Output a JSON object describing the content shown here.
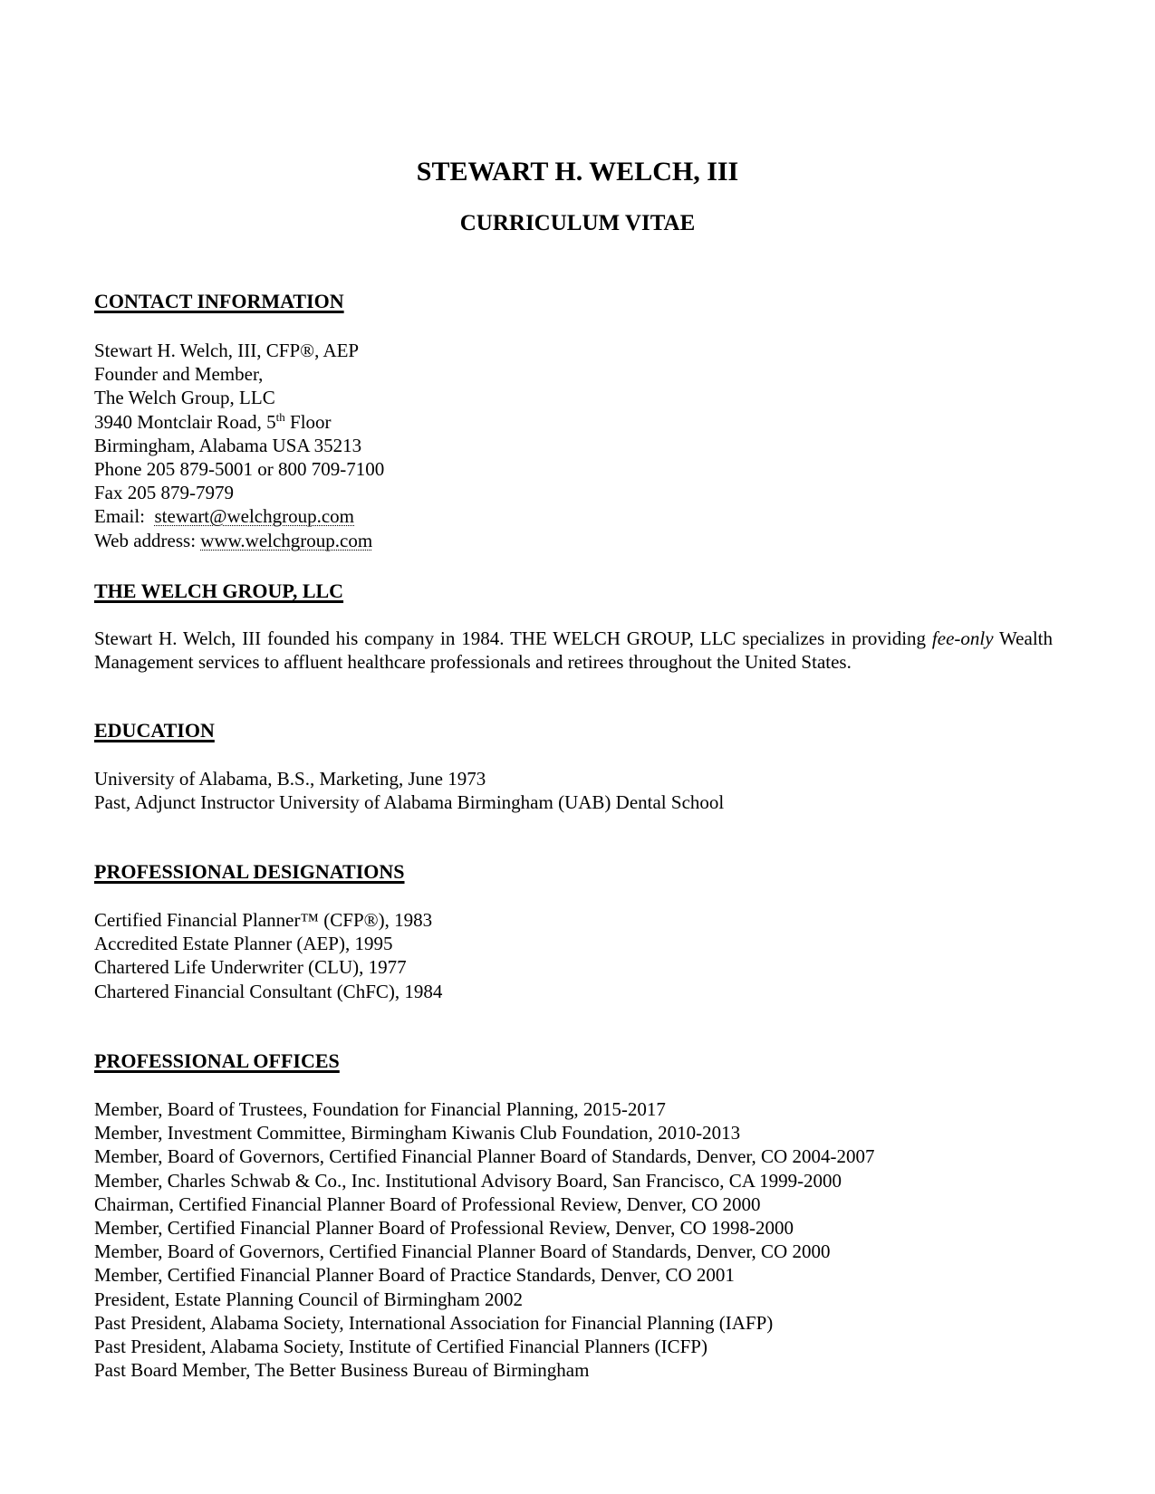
{
  "header": {
    "name": "STEWART H. WELCH, III",
    "subtitle": "CURRICULUM VITAE"
  },
  "contact": {
    "heading": "CONTACT INFORMATION",
    "name_line": "Stewart H. Welch, III, CFP®, AEP",
    "role_line": "Founder and Member,",
    "company_line": "The Welch Group, LLC",
    "address_prefix": "3940 Montclair Road, 5",
    "address_sup": "th",
    "address_suffix": " Floor",
    "city_line": "Birmingham, Alabama USA  35213",
    "phone_line": "Phone 205 879-5001 or 800 709-7100",
    "fax_line": "Fax 205 879-7979",
    "email_label": "Email:  ",
    "email": "stewart@welchgroup.com",
    "web_label": "Web address: ",
    "web": "www.welchgroup.com"
  },
  "company": {
    "heading": "THE WELCH GROUP, LLC",
    "text_before": "Stewart H. Welch, III founded his company in 1984.  THE WELCH GROUP, LLC specializes in providing ",
    "emphasis": "fee-only",
    "text_after": " Wealth Management services to affluent healthcare professionals and retirees throughout the United States."
  },
  "education": {
    "heading": "EDUCATION",
    "items": [
      "University of Alabama, B.S., Marketing, June 1973",
      "Past, Adjunct Instructor University of Alabama Birmingham (UAB) Dental School"
    ]
  },
  "designations": {
    "heading": "PROFESSIONAL DESIGNATIONS",
    "items": [
      "Certified Financial Planner™ (CFP®), 1983",
      "Accredited Estate Planner (AEP), 1995",
      "Chartered Life Underwriter (CLU), 1977",
      "Chartered Financial Consultant (ChFC), 1984"
    ]
  },
  "offices": {
    "heading": "PROFESSIONAL OFFICES",
    "items": [
      "Member, Board of Trustees, Foundation for Financial Planning, 2015-2017",
      "Member, Investment Committee, Birmingham Kiwanis Club Foundation, 2010-2013",
      "Member, Board of Governors, Certified Financial Planner Board of Standards, Denver, CO  2004-2007",
      "Member, Charles Schwab & Co., Inc. Institutional Advisory Board, San Francisco, CA 1999-2000",
      "Chairman, Certified Financial Planner Board of Professional Review, Denver, CO  2000",
      "Member, Certified Financial Planner Board of Professional Review, Denver, CO  1998-2000",
      "Member, Board of Governors, Certified Financial Planner Board of Standards, Denver, CO  2000",
      "Member, Certified Financial Planner Board of Practice Standards, Denver, CO  2001",
      "President, Estate Planning Council of Birmingham 2002",
      "Past President, Alabama Society, International Association for Financial Planning (IAFP)",
      "Past President, Alabama Society, Institute of Certified Financial Planners (ICFP)",
      "Past Board Member, The Better Business Bureau of Birmingham"
    ]
  }
}
